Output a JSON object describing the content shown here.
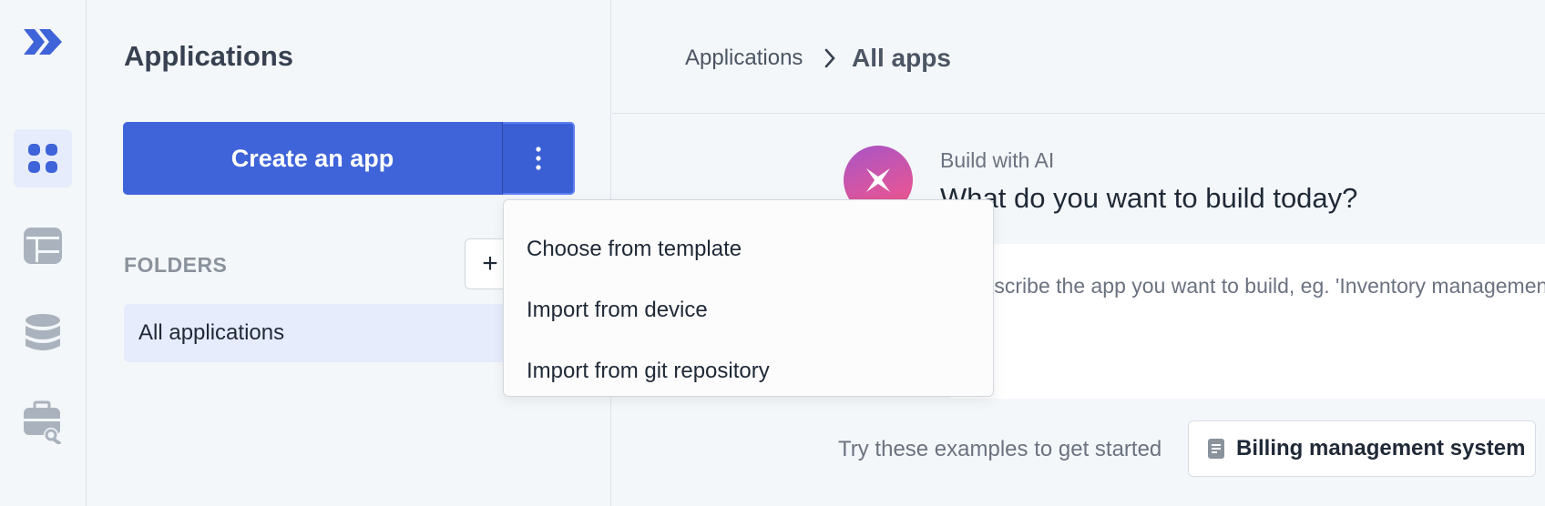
{
  "rail": {
    "items": [
      {
        "icon": "apps-grid-icon",
        "active": true
      },
      {
        "icon": "table-icon",
        "active": false
      },
      {
        "icon": "database-icon",
        "active": false
      },
      {
        "icon": "toolbox-icon",
        "active": false
      }
    ],
    "accent": "#3f63d9"
  },
  "panel": {
    "title": "Applications",
    "create_label": "Create an app",
    "folders_label": "FOLDERS",
    "add_folder_label": "+",
    "folders": [
      "All applications"
    ]
  },
  "breadcrumb": {
    "first": "Applications",
    "current": "All apps"
  },
  "ai": {
    "label": "Build with AI",
    "question": "What do you want to build today?",
    "prompt_placeholder": "Describe the app you want to build, eg. 'Inventory management system'"
  },
  "examples": {
    "label": "Try these examples to get started",
    "items": [
      "Billing management system"
    ]
  },
  "menu": {
    "items": [
      "Choose from template",
      "Import from device",
      "Import from git repository"
    ]
  }
}
